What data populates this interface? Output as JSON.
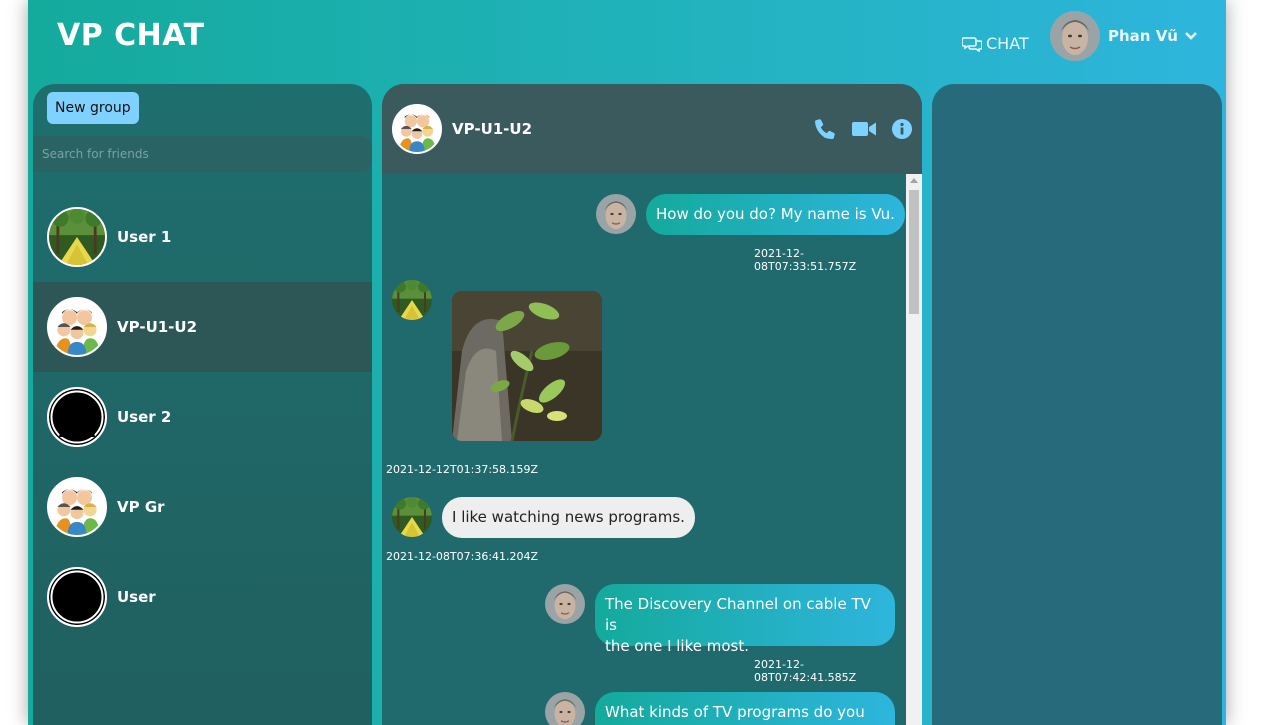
{
  "header": {
    "brand": "VP CHAT",
    "nav_chat_label": "CHAT",
    "user_name": "Phan Vũ"
  },
  "sidebar": {
    "new_group_label": "New group",
    "search_placeholder": "Search for friends",
    "contacts": [
      {
        "name": "User 1",
        "avatar": "forest-avatar",
        "active": false
      },
      {
        "name": "VP-U1-U2",
        "avatar": "group-avatar",
        "active": true
      },
      {
        "name": "User 2",
        "avatar": "default-user-avatar",
        "active": false
      },
      {
        "name": "VP Gr",
        "avatar": "group-avatar",
        "active": false
      },
      {
        "name": "User",
        "avatar": "default-user-avatar",
        "active": false
      }
    ]
  },
  "chat": {
    "title": "VP-U1-U2",
    "icons": [
      "phone-icon",
      "video-camera-icon",
      "info-icon"
    ],
    "messages": [
      {
        "direction": "out",
        "text": "How do you do? My name is Vu.",
        "timestamp": "2021-12-08T07:33:51.757Z"
      },
      {
        "direction": "in",
        "type": "image",
        "image": "plant-photo",
        "timestamp": "2021-12-12T01:37:58.159Z"
      },
      {
        "direction": "in",
        "text": "I like watching news programs.",
        "timestamp": "2021-12-08T07:36:41.204Z"
      },
      {
        "direction": "out",
        "text_line1": "The Discovery Channel on cable TV is",
        "text_line2": "the one I like most.",
        "timestamp": "2021-12-08T07:42:41.585Z"
      },
      {
        "direction": "out",
        "text_line1": "What kinds of TV programs do you"
      }
    ]
  },
  "colors": {
    "gradient_start": "#14aa9c",
    "gradient_end": "#2eb5dd",
    "panel_dark": "#206a6e",
    "header_dark": "#3a5a5d",
    "icon_accent": "#7fd2ff"
  }
}
